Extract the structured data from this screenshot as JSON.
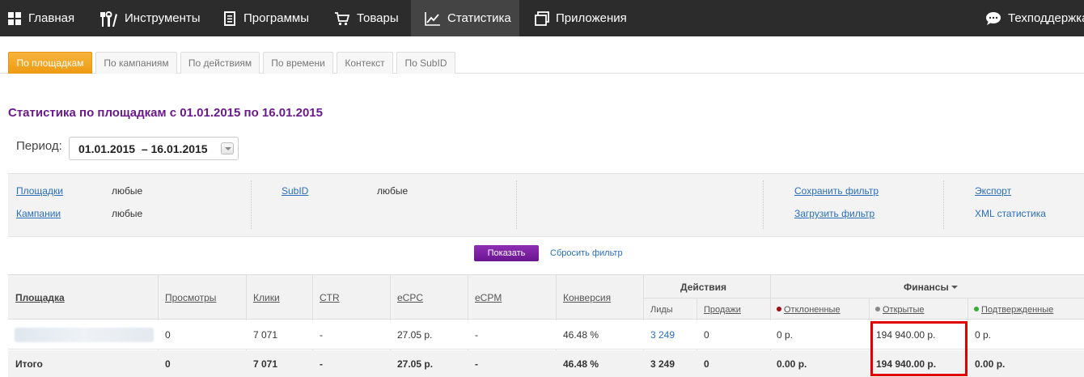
{
  "nav": {
    "items": [
      {
        "label": "Главная",
        "icon": "grid-icon"
      },
      {
        "label": "Инструменты",
        "icon": "tools-icon"
      },
      {
        "label": "Программы",
        "icon": "document-icon"
      },
      {
        "label": "Товары",
        "icon": "cart-icon"
      },
      {
        "label": "Статистика",
        "icon": "chart-line-icon",
        "active": true
      },
      {
        "label": "Приложения",
        "icon": "windows-icon"
      }
    ],
    "support_label": "Техподдержка"
  },
  "tabs": [
    {
      "label": "По площадкам",
      "active": true
    },
    {
      "label": "По кампаниям"
    },
    {
      "label": "По действиям"
    },
    {
      "label": "По времени"
    },
    {
      "label": "Контекст"
    },
    {
      "label": "По SubID"
    }
  ],
  "page_title": "Статистика по площадкам с 01.01.2015 по 16.01.2015",
  "period": {
    "label": "Период:",
    "value": "01.01.2015  – 16.01.2015"
  },
  "filter": {
    "platforms_label": "Площадки",
    "platforms_value": "любые",
    "campaigns_label": "Кампании",
    "campaigns_value": "любые",
    "subid_label": "SubID",
    "subid_value": "любые",
    "save_filter": "Сохранить фильтр",
    "load_filter": "Загрузить фильтр",
    "export": "Экспорт",
    "xml_stats": "XML статистика"
  },
  "actions": {
    "show": "Показать",
    "reset": "Сбросить фильтр"
  },
  "table": {
    "headers": {
      "platform": "Площадка",
      "views": "Просмотры",
      "clicks": "Клики",
      "ctr": "CTR",
      "ecpc": "eCPC",
      "ecpm": "eCPM",
      "conversion": "Конверсия",
      "actions_group": "Действия",
      "leads": "Лиды",
      "sales": "Продажи",
      "finance_group": "Финансы",
      "rejected": "Отклоненные",
      "open": "Открытые",
      "confirmed": "Подтвержденные"
    },
    "status_colors": {
      "rejected": "#a01010",
      "open": "#888888",
      "confirmed": "#3aaa35"
    },
    "row": {
      "views": "0",
      "clicks": "7 071",
      "ctr": "-",
      "ecpc": "27.05 р.",
      "ecpm": "-",
      "conversion": "46.48 %",
      "leads": "3 249",
      "sales": "0",
      "rejected": "0 р.",
      "open": "194 940.00 р.",
      "confirmed": "0 р."
    },
    "total": {
      "label": "Итого",
      "views": "0",
      "clicks": "7 071",
      "ctr": "-",
      "ecpc": "27.05 р.",
      "ecpm": "-",
      "conversion": "46.48 %",
      "leads": "3 249",
      "sales": "0",
      "rejected": "0.00 р.",
      "open": "194 940.00 р.",
      "confirmed": "0.00 р."
    }
  },
  "colors": {
    "nav_bg": "#2c2c2c",
    "accent_orange": "#f5a623",
    "title_purple": "#6b1a8c",
    "button_purple": "#7a1fa2",
    "link_blue": "#2a6ebb",
    "highlight_red": "#e00000"
  }
}
